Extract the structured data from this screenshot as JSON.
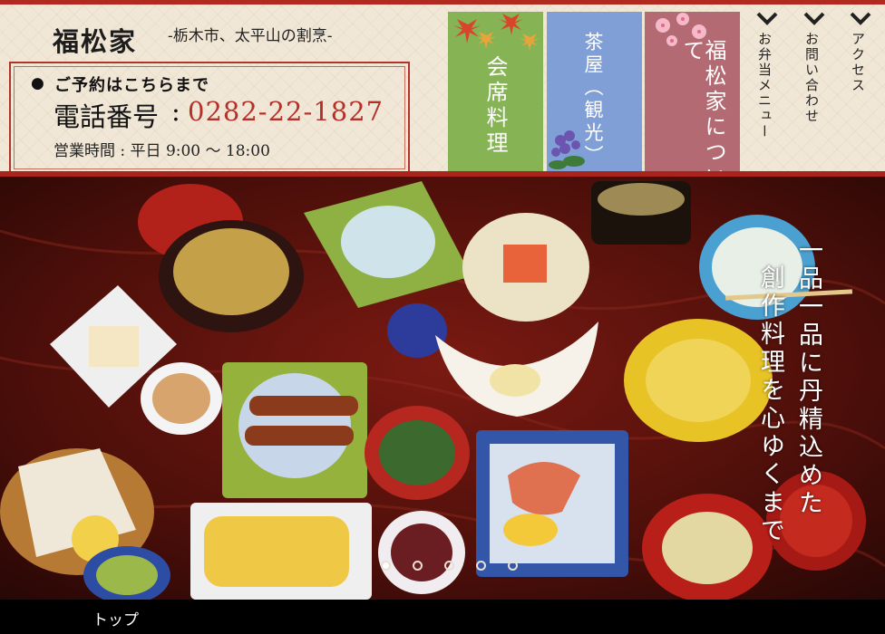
{
  "header": {
    "logo": "福松家",
    "tagline": "-栃木市、太平山の割烹-",
    "reservation_label": "ご予約はこちらまで",
    "phone_label": "電話番号",
    "phone_colon": ":",
    "phone_number": "0282-22-1827",
    "hours": "営業時間 : 平日 9:00 ～ 18:00"
  },
  "nav_cards": [
    {
      "label": "会席料理",
      "color": "#86b455"
    },
    {
      "label": "茶屋（観光）",
      "color": "#7f9fd6"
    },
    {
      "label": "福松家について",
      "color": "#b46a72"
    }
  ],
  "side_links": [
    {
      "label": "お弁当メニュー",
      "icon": "chevron-down-icon"
    },
    {
      "label": "お問い合わせ",
      "icon": "chevron-down-icon"
    },
    {
      "label": "アクセス",
      "icon": "chevron-down-icon"
    }
  ],
  "hero": {
    "tagline_line1": "一品一品に丹精込めた",
    "tagline_line2": "創作料理を心ゆくまで",
    "slides_count": 5,
    "active_slide": 1
  },
  "footer": {
    "home_label": "トップ"
  },
  "colors": {
    "accent_red": "#b02a20",
    "phone_red": "#b4312a",
    "header_bg": "#f1e7d6"
  }
}
